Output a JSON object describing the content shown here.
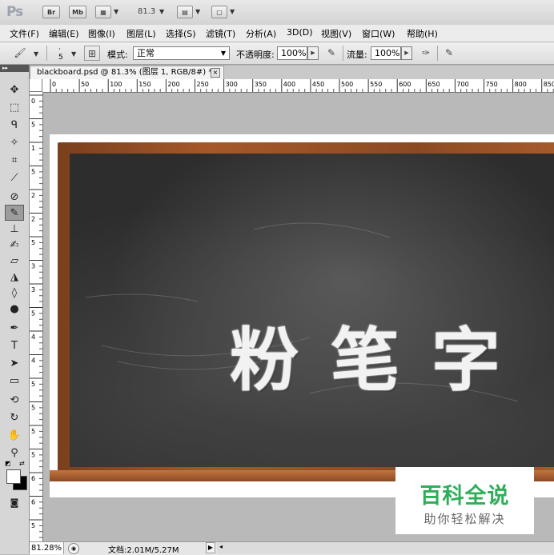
{
  "appbar": {
    "logo": "Ps",
    "bridge_label": "Br",
    "minibridge_label": "Mb",
    "zoom_value": "81.3"
  },
  "menu": [
    "文件(F)",
    "编辑(E)",
    "图像(I)",
    "图层(L)",
    "选择(S)",
    "滤镜(T)",
    "分析(A)",
    "3D(D)",
    "视图(V)",
    "窗口(W)",
    "帮助(H)"
  ],
  "options": {
    "brush_size": "5",
    "mode_label": "模式:",
    "mode_value": "正常",
    "opacity_label": "不透明度:",
    "opacity_value": "100%",
    "flow_label": "流量:",
    "flow_value": "100%"
  },
  "document": {
    "tab_title": "blackboard.psd @ 81.3% (图层 1, RGB/8#) *",
    "close_glyph": "×",
    "chalk_text": "粉笔字"
  },
  "ruler": {
    "h_ticks": [
      "0",
      "50",
      "100",
      "150",
      "200",
      "250",
      "300",
      "350",
      "400",
      "450",
      "500",
      "550",
      "600",
      "650",
      "700",
      "750",
      "800",
      "850"
    ],
    "v_ticks": [
      "0",
      "5",
      "1",
      "5",
      "2",
      "2",
      "5",
      "3",
      "3",
      "5",
      "4",
      "4",
      "5",
      "5",
      "5",
      "5",
      "6",
      "6",
      "5"
    ]
  },
  "status": {
    "zoom": "81.28%",
    "doc_info": "文档:2.01M/5.27M"
  },
  "watermark": {
    "title": "百科全说",
    "subtitle": "助你轻松解决"
  },
  "colors": {
    "board": "#2d2d2d",
    "frame": "#9a5228",
    "chalk": "#f2f2f2",
    "watermark_green": "#2fae5a"
  }
}
